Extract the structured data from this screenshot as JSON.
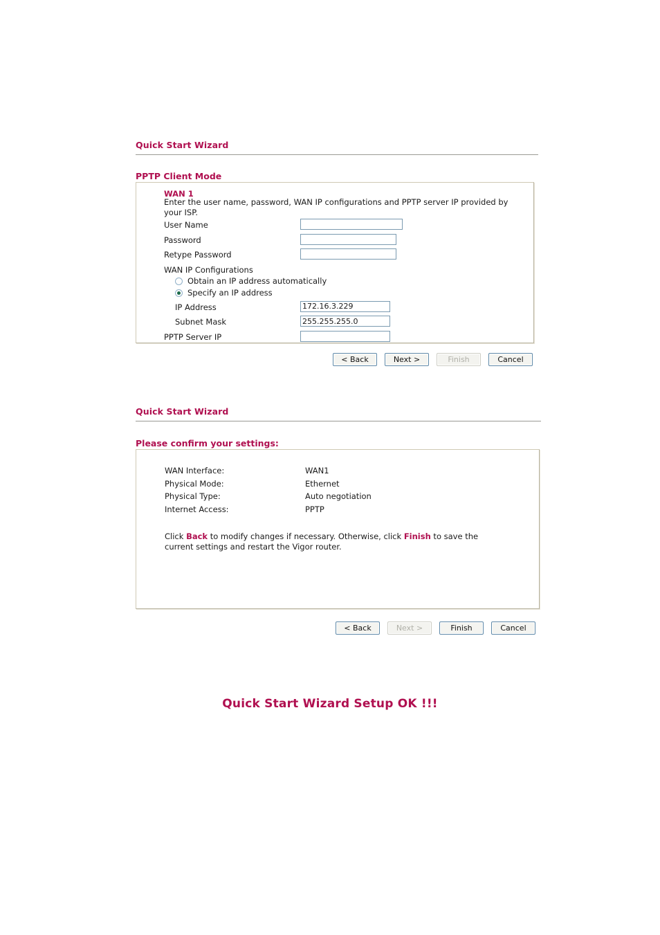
{
  "page": {
    "setup_ok_text": "Quick Start Wizard Setup OK !!!",
    "accent_color": "#b01050",
    "panel_border_color": "#cfc9b4",
    "input_border_color": "#7a9ab0",
    "radio_dot_color": "#1c6b4a"
  },
  "step_pptp": {
    "wizard_title": "Quick Start Wizard",
    "mode_label": "PPTP Client Mode",
    "wan_heading": "WAN 1",
    "hint": "Enter the user name, password, WAN IP configurations and PPTP server IP provided by your ISP.",
    "fields": {
      "user_name": {
        "label": "User Name",
        "value": "",
        "placeholder": ""
      },
      "password": {
        "label": "Password",
        "value": "",
        "placeholder": ""
      },
      "retype_password": {
        "label": "Retype Password",
        "value": "",
        "placeholder": ""
      },
      "wan_ip_configurations_label": "WAN IP Configurations",
      "ip_address": {
        "label": "IP Address",
        "value": "172.16.3.229",
        "placeholder": ""
      },
      "subnet_mask": {
        "label": "Subnet Mask",
        "value": "255.255.255.0",
        "placeholder": ""
      },
      "pptp_server_ip": {
        "label": "PPTP Server IP",
        "value": "",
        "placeholder": ""
      }
    },
    "radios": {
      "obtain_auto": {
        "label": "Obtain an IP address automatically",
        "checked": false
      },
      "specify": {
        "label": "Specify an IP address",
        "checked": true
      }
    },
    "buttons": {
      "back": {
        "label": "< Back",
        "disabled": false
      },
      "next": {
        "label": "Next >",
        "disabled": false
      },
      "finish": {
        "label": "Finish",
        "disabled": true
      },
      "cancel": {
        "label": "Cancel",
        "disabled": false
      }
    }
  },
  "step_confirm": {
    "wizard_title": "Quick Start Wizard",
    "confirm_label": "Please confirm your settings:",
    "summary": [
      {
        "label": "WAN Interface:",
        "value": "WAN1"
      },
      {
        "label": "Physical Mode:",
        "value": "Ethernet"
      },
      {
        "label": "Physical Type:",
        "value": "Auto negotiation"
      },
      {
        "label": "Internet Access:",
        "value": "PPTP"
      }
    ],
    "note": {
      "part1": "Click ",
      "back_word": "Back",
      "part2": " to modify changes if necessary. Otherwise, click ",
      "finish_word": "Finish",
      "part3": " to save the current settings and restart the Vigor router."
    },
    "buttons": {
      "back": {
        "label": "< Back",
        "disabled": false
      },
      "next": {
        "label": "Next >",
        "disabled": true
      },
      "finish": {
        "label": "Finish",
        "disabled": false
      },
      "cancel": {
        "label": "Cancel",
        "disabled": false
      }
    }
  }
}
